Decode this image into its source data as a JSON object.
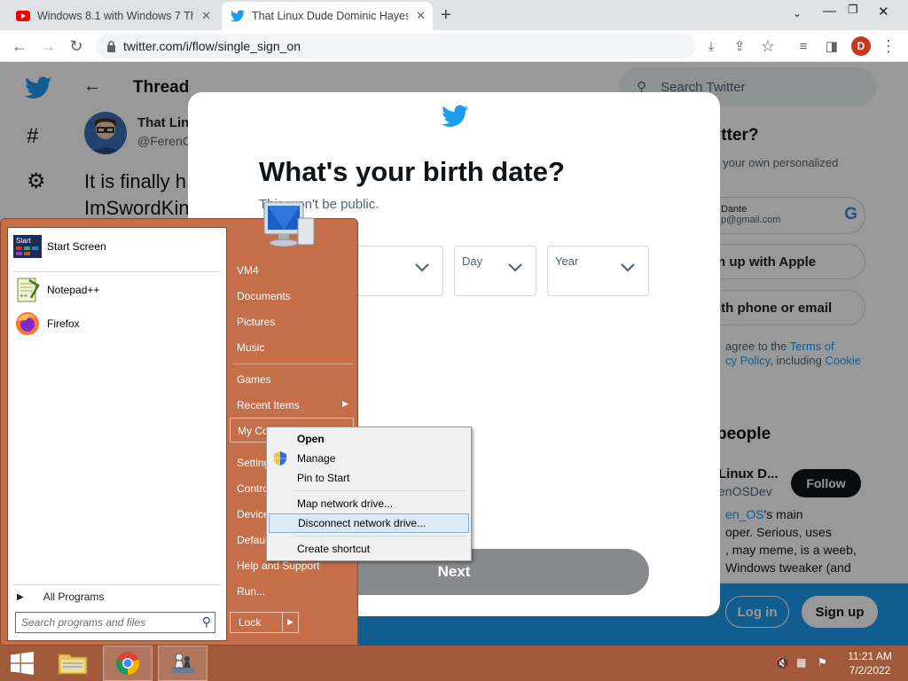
{
  "browser": {
    "tabs": [
      {
        "title": "Windows 8.1 with Windows 7 Th",
        "favicon": "youtube-icon"
      },
      {
        "title": "That Linux Dude Dominic Hayes",
        "favicon": "twitter-icon"
      }
    ],
    "new_tab_glyph": "+",
    "url": "twitter.com/i/flow/single_sign_on",
    "profile_initial": "D"
  },
  "twitter": {
    "header_title": "Thread",
    "tweet": {
      "name": "That Lin",
      "handle": "@FerenC",
      "text_line1": "It is finally h",
      "text_line2": "ImSwordKin"
    },
    "search_placeholder": "Search Twitter",
    "sidebar": {
      "heading": "itter?",
      "subtext": "t your own personalized",
      "google_name": "Dante",
      "google_email": "p@gmail.com",
      "apple_label": "n up with Apple",
      "phone_label": "ith phone or email",
      "terms_prefix": "agree to the",
      "terms_link": "Terms of",
      "policy_link": "cy Policy",
      "including": ", including",
      "cookie_link": "Cookie",
      "people_heading": "people",
      "suggest_name": "Linux D...",
      "suggest_handle": "enOSDev",
      "follow_label": "Follow",
      "bio_link": "en_OS",
      "bio_line1": "'s main",
      "bio_line2": "oper. Serious, uses",
      "bio_line3": ", may meme, is a weeb,",
      "bio_line4": "Windows tweaker (and"
    },
    "login_label": "Log in",
    "signup_label": "Sign up"
  },
  "modal": {
    "title": "What's your birth date?",
    "subtitle": "This won't be public.",
    "fields": {
      "day_label": "Day",
      "year_label": "Year"
    },
    "next_label": "Next"
  },
  "start_menu": {
    "pinned": [
      {
        "label": "Start Screen",
        "icon": "start-screen-icon"
      },
      {
        "label": "Notepad++",
        "icon": "notepad-plus-plus-icon"
      },
      {
        "label": "Firefox",
        "icon": "firefox-icon"
      }
    ],
    "all_programs": "All Programs",
    "search_placeholder": "Search programs and files",
    "right_links": {
      "user": "VM4",
      "documents": "Documents",
      "pictures": "Pictures",
      "music": "Music",
      "games": "Games",
      "recent_items": "Recent Items",
      "my_computer": "My Co",
      "settings": "Setting",
      "control": "Contro",
      "devices": "Device",
      "defaults": "Defaul",
      "help": "Help and Support",
      "run": "Run..."
    },
    "lock_label": "Lock"
  },
  "context_menu": {
    "items": [
      {
        "label": "Open",
        "bold": true
      },
      {
        "label": "Manage"
      },
      {
        "label": "Pin to Start"
      },
      {
        "label": "Map network drive..."
      },
      {
        "label": "Disconnect network drive...",
        "hovered": true
      },
      {
        "label": "Create shortcut"
      }
    ]
  },
  "taskbar": {
    "time": "11:21 AM",
    "date": "7/2/2022"
  },
  "colors": {
    "twitter_blue": "#1d9bf0",
    "start_menu": "#c56e4a",
    "taskbar": "#a0593b"
  }
}
